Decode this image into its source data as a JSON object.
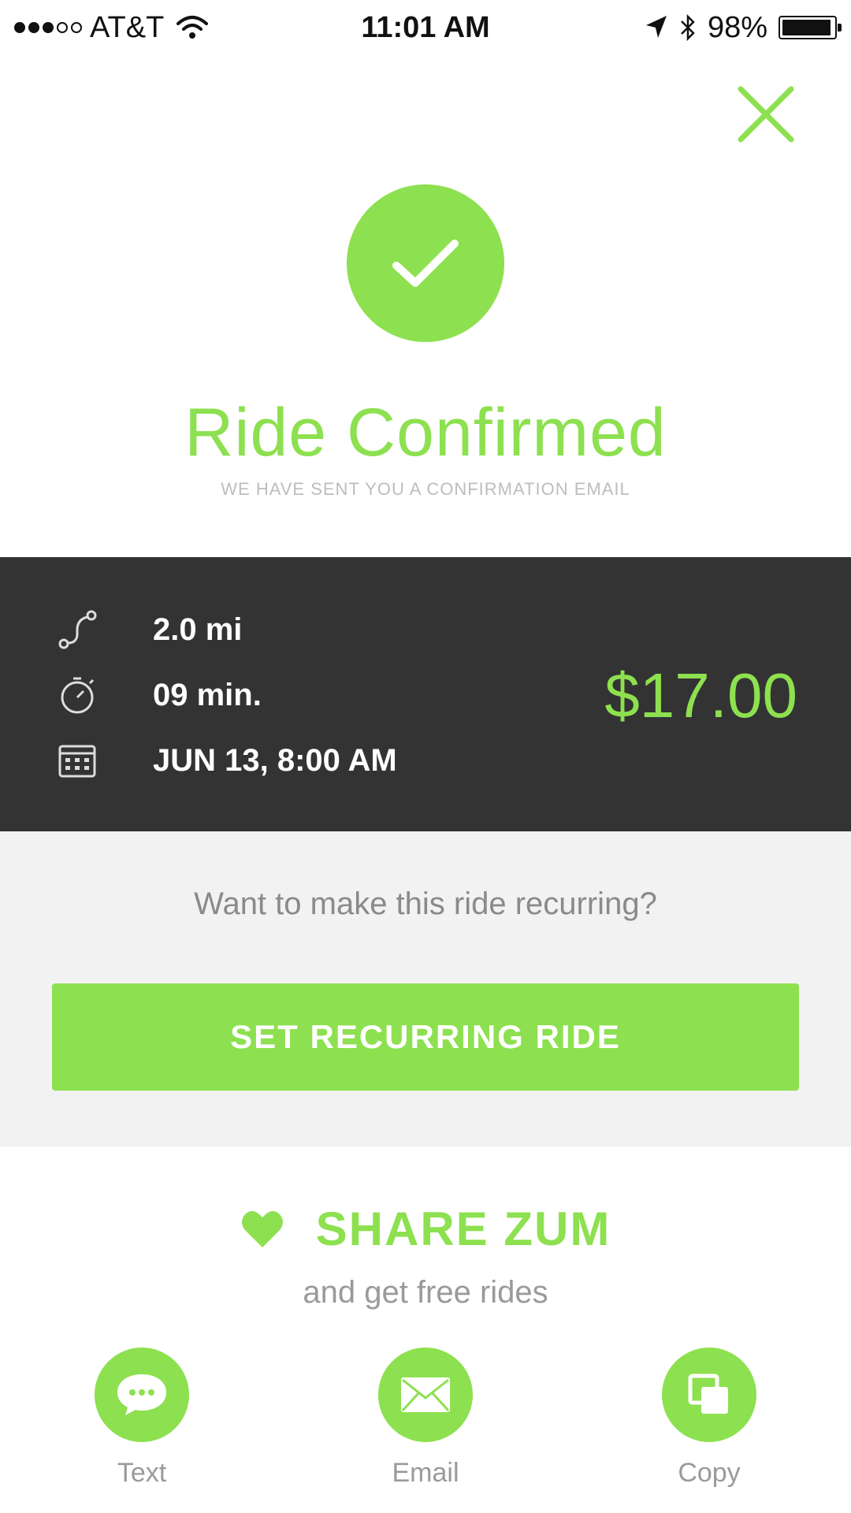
{
  "status_bar": {
    "carrier": "AT&T",
    "time": "11:01 AM",
    "battery_percent": "98%",
    "signal_bars_filled": 3,
    "signal_bars_total": 5
  },
  "header": {
    "close_icon": "close-icon"
  },
  "confirmation": {
    "icon": "checkmark-icon",
    "title": "Ride Confirmed",
    "subtitle": "WE HAVE SENT YOU A CONFIRMATION EMAIL"
  },
  "summary": {
    "distance": "2.0 mi",
    "duration": "09 min.",
    "datetime": "JUN 13, 8:00 AM",
    "price": "$17.00"
  },
  "recurring": {
    "question": "Want to make this ride recurring?",
    "button_label": "SET RECURRING RIDE"
  },
  "share": {
    "title": "SHARE ZUM",
    "subtitle": "and get free rides",
    "options": [
      {
        "label": "Text",
        "icon": "chat-bubble-icon"
      },
      {
        "label": "Email",
        "icon": "envelope-icon"
      },
      {
        "label": "Copy",
        "icon": "copy-icon"
      }
    ]
  },
  "colors": {
    "accent": "#8de04f",
    "dark_panel": "#333333",
    "light_panel": "#f2f2f2"
  }
}
